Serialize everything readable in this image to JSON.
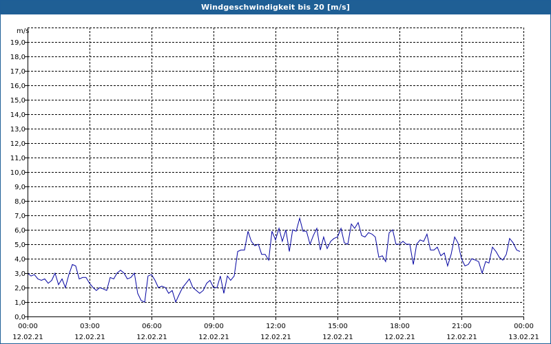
{
  "window": {
    "title": "Windgeschwindigkeit bis 20 [m/s]"
  },
  "colors": {
    "titlebar": "#1f5f95",
    "series": "#0000a0",
    "grid": "#000000"
  },
  "chart_data": {
    "type": "line",
    "title": "Windgeschwindigkeit bis 20 [m/s]",
    "ylabel": "m/s",
    "xlabel": "",
    "ylim": [
      0,
      20
    ],
    "xlim_hours": [
      0,
      24
    ],
    "grid": true,
    "legend": "none",
    "y_ticks": [
      "0,0",
      "1,0",
      "2,0",
      "3,0",
      "4,0",
      "5,0",
      "6,0",
      "7,0",
      "8,0",
      "9,0",
      "10,0",
      "11,0",
      "12,0",
      "13,0",
      "14,0",
      "15,0",
      "16,0",
      "17,0",
      "18,0",
      "19,0"
    ],
    "x_ticks": [
      {
        "time": "00:00",
        "date": "12.02.21"
      },
      {
        "time": "03:00",
        "date": "12.02.21"
      },
      {
        "time": "06:00",
        "date": "12.02.21"
      },
      {
        "time": "09:00",
        "date": "12.02.21"
      },
      {
        "time": "12:00",
        "date": "12.02.21"
      },
      {
        "time": "15:00",
        "date": "12.02.21"
      },
      {
        "time": "18:00",
        "date": "12.02.21"
      },
      {
        "time": "21:00",
        "date": "12.02.21"
      },
      {
        "time": "00:00",
        "date": "13.02.21"
      }
    ],
    "series": [
      {
        "x": [
          0,
          0.17,
          0.33,
          0.5,
          0.67,
          0.83,
          1,
          1.17,
          1.33,
          1.5,
          1.67,
          1.83,
          2,
          2.17,
          2.33,
          2.5,
          2.67,
          2.83,
          3,
          3.17,
          3.33,
          3.5,
          3.67,
          3.83,
          4,
          4.17,
          4.33,
          4.5,
          4.67,
          4.83,
          5,
          5.17,
          5.33,
          5.5,
          5.67,
          5.83,
          6,
          6.17,
          6.33,
          6.5,
          6.67,
          6.83,
          7,
          7.17,
          7.33,
          7.5,
          7.67,
          7.83,
          8,
          8.17,
          8.33,
          8.5,
          8.67,
          8.83,
          9,
          9.17,
          9.33,
          9.5,
          9.67,
          9.83,
          10,
          10.17,
          10.33,
          10.5,
          10.67,
          10.83,
          11,
          11.17,
          11.33,
          11.5,
          11.67,
          11.83,
          12,
          12.17,
          12.33,
          12.5,
          12.67,
          12.83,
          13,
          13.17,
          13.33,
          13.5,
          13.67,
          13.83,
          14,
          14.17,
          14.33,
          14.5,
          14.67,
          14.83,
          15,
          15.17,
          15.33,
          15.5,
          15.67,
          15.83,
          16,
          16.17,
          16.33,
          16.5,
          16.67,
          16.83,
          17,
          17.17,
          17.33,
          17.5,
          17.67,
          17.83,
          18,
          18.17,
          18.33,
          18.5,
          18.67,
          18.83,
          19,
          19.17,
          19.33,
          19.5,
          19.67,
          19.83,
          20,
          20.17,
          20.33,
          20.5,
          20.67,
          20.83,
          21,
          21.17,
          21.33,
          21.5,
          21.67,
          21.83,
          22,
          22.17,
          22.33,
          22.5,
          22.67,
          22.83,
          23,
          23.17,
          23.33,
          23.5,
          23.67,
          23.83
        ],
        "values": [
          3.0,
          2.8,
          2.9,
          2.6,
          2.5,
          2.6,
          2.3,
          2.5,
          3.0,
          2.2,
          2.6,
          2.0,
          2.9,
          3.6,
          3.5,
          2.6,
          2.7,
          2.7,
          2.3,
          2.0,
          1.8,
          2.0,
          1.9,
          1.8,
          2.7,
          2.6,
          3.0,
          3.2,
          3.0,
          2.6,
          2.7,
          3.0,
          1.6,
          1.1,
          1.0,
          2.8,
          2.9,
          2.5,
          2.0,
          2.1,
          2.0,
          1.6,
          1.8,
          1.0,
          1.5,
          2.0,
          2.3,
          2.6,
          2.0,
          1.8,
          1.6,
          1.8,
          2.3,
          2.5,
          2.0,
          2.0,
          2.8,
          1.6,
          2.8,
          2.5,
          2.8,
          4.5,
          4.6,
          4.6,
          5.9,
          5.2,
          4.9,
          5.0,
          4.3,
          4.3,
          3.9,
          5.9,
          5.3,
          6.1,
          5.2,
          6.0,
          4.5,
          6.0,
          5.9,
          6.8,
          5.9,
          5.9,
          5.0,
          5.6,
          6.1,
          4.6,
          5.5,
          4.7,
          5.2,
          5.4,
          5.5,
          6.1,
          5.1,
          5.0,
          6.4,
          6.1,
          6.5,
          5.6,
          5.5,
          5.8,
          5.7,
          5.5,
          4.1,
          4.2,
          3.8,
          5.8,
          6.0,
          5.0,
          5.0,
          5.2,
          5.0,
          5.0,
          3.6,
          5.0,
          5.3,
          5.2,
          5.7,
          4.6,
          4.6,
          4.8,
          4.2,
          4.4,
          3.5,
          4.3,
          5.5,
          5.1,
          4.0,
          3.5,
          3.6,
          4.0,
          3.9,
          3.8,
          3.0,
          3.8,
          3.7,
          4.8,
          4.5,
          4.1,
          3.9,
          4.3,
          5.4,
          5.1,
          4.6,
          4.5
        ]
      }
    ]
  }
}
